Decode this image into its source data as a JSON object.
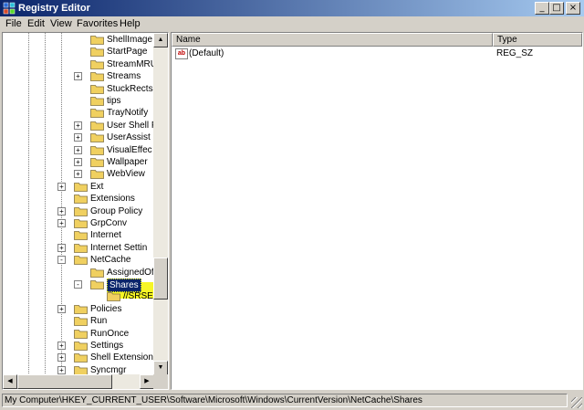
{
  "window": {
    "title": "Registry Editor",
    "controls": {
      "minimize": "_",
      "maximize": "□",
      "close": "×"
    }
  },
  "menu": [
    "File",
    "Edit",
    "View",
    "Favorites",
    "Help"
  ],
  "tree": {
    "items": [
      {
        "label": "ShellImage",
        "expander": "",
        "level": 3
      },
      {
        "label": "StartPage",
        "expander": "",
        "level": 3
      },
      {
        "label": "StreamMRU",
        "expander": "",
        "level": 3
      },
      {
        "label": "Streams",
        "expander": "+",
        "level": 3
      },
      {
        "label": "StuckRects",
        "expander": "",
        "level": 3
      },
      {
        "label": "tips",
        "expander": "",
        "level": 3
      },
      {
        "label": "TrayNotify",
        "expander": "",
        "level": 3
      },
      {
        "label": "User Shell F",
        "expander": "+",
        "level": 3
      },
      {
        "label": "UserAssist",
        "expander": "+",
        "level": 3
      },
      {
        "label": "VisualEffec",
        "expander": "+",
        "level": 3
      },
      {
        "label": "Wallpaper",
        "expander": "+",
        "level": 3
      },
      {
        "label": "WebView",
        "expander": "+",
        "level": 3
      },
      {
        "label": "Ext",
        "expander": "+",
        "level": 2
      },
      {
        "label": "Extensions",
        "expander": "",
        "level": 2
      },
      {
        "label": "Group Policy",
        "expander": "+",
        "level": 2
      },
      {
        "label": "GrpConv",
        "expander": "+",
        "level": 2
      },
      {
        "label": "Internet",
        "expander": "",
        "level": 2
      },
      {
        "label": "Internet Settin",
        "expander": "+",
        "level": 2
      },
      {
        "label": "NetCache",
        "expander": "-",
        "level": 2
      },
      {
        "label": "AssignedOf",
        "expander": "",
        "level": 3
      },
      {
        "label": "Shares",
        "expander": "-",
        "level": 3,
        "selected": true
      },
      {
        "label": "//SRSE",
        "expander": "",
        "level": 4
      },
      {
        "label": "Policies",
        "expander": "+",
        "level": 2
      },
      {
        "label": "Run",
        "expander": "",
        "level": 2
      },
      {
        "label": "RunOnce",
        "expander": "",
        "level": 2
      },
      {
        "label": "Settings",
        "expander": "+",
        "level": 2
      },
      {
        "label": "Shell Extension",
        "expander": "+",
        "level": 2
      },
      {
        "label": "Syncmgr",
        "expander": "+",
        "level": 2
      }
    ]
  },
  "list": {
    "columns": [
      "Name",
      "Type"
    ],
    "rows": [
      {
        "icon": "ab",
        "name": "(Default)",
        "type": "REG_SZ"
      }
    ]
  },
  "statusbar": {
    "path": "My Computer\\HKEY_CURRENT_USER\\Software\\Microsoft\\Windows\\CurrentVersion\\NetCache\\Shares"
  },
  "colors": {
    "title_start": "#0a246a",
    "title_end": "#a6caf0",
    "selection": "#0a246a",
    "highlight": "#f4f400",
    "folder": "#f0d060"
  }
}
